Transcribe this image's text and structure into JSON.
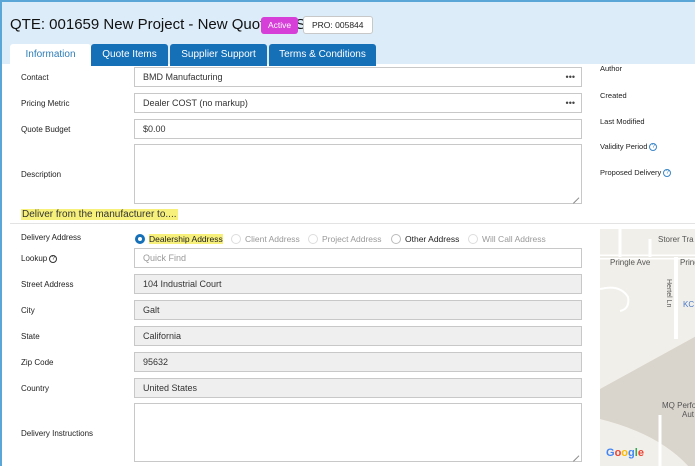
{
  "header": {
    "title": "QTE: 001659 New Project - New Quote TEST",
    "status_badge": "Active",
    "pro_badge": "PRO: 005844",
    "status_color": "#d63fd8"
  },
  "tabs": [
    {
      "label": "Information",
      "active": true
    },
    {
      "label": "Quote Items"
    },
    {
      "label": "Supplier Support"
    },
    {
      "label": "Terms & Conditions"
    }
  ],
  "form": {
    "contact": {
      "label": "Contact",
      "value": "BMD Manufacturing"
    },
    "pricing_metric": {
      "label": "Pricing Metric",
      "value": "Dealer COST (no markup)"
    },
    "quote_budget": {
      "label": "Quote Budget",
      "value": "$0.00"
    },
    "description": {
      "label": "Description",
      "value": ""
    }
  },
  "right_panel": {
    "author": "Author",
    "created": "Created",
    "last_modified": "Last Modified",
    "validity_period": "Validity Period",
    "proposed_delivery": "Proposed Delivery"
  },
  "delivery": {
    "section_title": "Deliver from the manufacturer to....",
    "address_label": "Delivery Address",
    "options": [
      {
        "label": "Dealership Address",
        "checked": true
      },
      {
        "label": "Client Address",
        "checked": false,
        "disabled": true
      },
      {
        "label": "Project Address",
        "checked": false,
        "disabled": true
      },
      {
        "label": "Other Address",
        "checked": false
      },
      {
        "label": "Will Call Address",
        "checked": false,
        "disabled": true
      }
    ],
    "lookup": {
      "label": "Lookup",
      "placeholder": "Quick Find"
    },
    "street": {
      "label": "Street Address",
      "value": "104 Industrial Court"
    },
    "city": {
      "label": "City",
      "value": "Galt"
    },
    "state": {
      "label": "State",
      "value": "California"
    },
    "zip": {
      "label": "Zip Code",
      "value": "95632"
    },
    "country": {
      "label": "Country",
      "value": "United States"
    },
    "instructions": {
      "label": "Delivery Instructions",
      "value": ""
    }
  },
  "map": {
    "labels": [
      "Storer Tra",
      "Pringle Ave",
      "Pring",
      "Hertel Ln",
      "KC",
      "MQ Perfo",
      "Aut"
    ],
    "brand": "Google"
  },
  "colors": {
    "accent": "#1570b8",
    "header_bg": "#dcecf8",
    "highlight": "#f7f07a"
  }
}
